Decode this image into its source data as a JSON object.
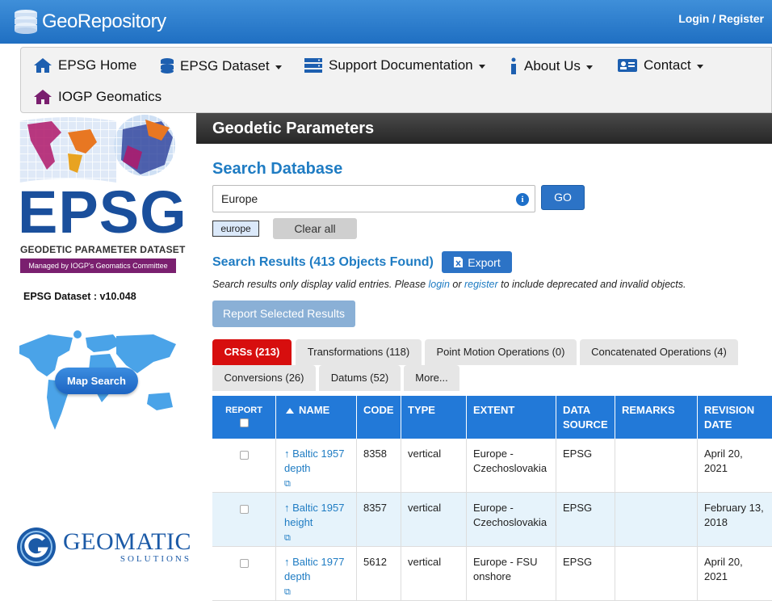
{
  "header": {
    "brand": "GeoRepository",
    "login": "Login / Register"
  },
  "nav": {
    "items": [
      {
        "label": "EPSG Home",
        "icon": "home-icon"
      },
      {
        "label": "EPSG Dataset",
        "icon": "database-icon"
      },
      {
        "label": "Support Documentation",
        "icon": "server-icon"
      },
      {
        "label": "About Us",
        "icon": "info-icon"
      },
      {
        "label": "Contact",
        "icon": "contact-card-icon"
      },
      {
        "label": "IOGP Geomatics",
        "icon": "home-icon"
      }
    ]
  },
  "sidebar": {
    "logo_text": "EPSG",
    "logo_sub": "GEODETIC PARAMETER DATASET",
    "logo_managed": "Managed by IOGP's Geomatics Committee",
    "dataset_version": "EPSG Dataset :  v10.048",
    "map_search": "Map Search",
    "geomatic_line1": "GEOMATIC",
    "geomatic_line2": "SOLUTIONS"
  },
  "main": {
    "section_title": "Geodetic Parameters",
    "search_title": "Search Database",
    "search_value": "Europe",
    "go_label": "GO",
    "tag": "europe",
    "clear_all": "Clear all",
    "results_title": "Search Results (413 Objects Found)",
    "export_label": "Export",
    "note_pre": "Search results only display valid entries. Please ",
    "note_login": "login",
    "note_mid": " or ",
    "note_register": "register",
    "note_post": " to include deprecated and invalid objects.",
    "report_selected": "Report Selected Results"
  },
  "tabs": [
    {
      "label": "CRSs (213)",
      "active": true
    },
    {
      "label": "Transformations (118)"
    },
    {
      "label": "Point Motion Operations (0)"
    },
    {
      "label": "Concatenated Operations (4)"
    },
    {
      "label": "Conversions (26)"
    },
    {
      "label": "Datums (52)"
    },
    {
      "label": "More..."
    }
  ],
  "table": {
    "headers": {
      "report": "REPORT",
      "name": "NAME",
      "code": "CODE",
      "type": "TYPE",
      "extent": "EXTENT",
      "source": "DATA SOURCE",
      "remarks": "REMARKS",
      "revision": "REVISION DATE"
    },
    "rows": [
      {
        "name": "Baltic 1957 depth",
        "code": "8358",
        "type": "vertical",
        "extent": "Europe - Czechoslovakia",
        "source": "EPSG",
        "remarks": "",
        "revision": "April 20, 2021"
      },
      {
        "name": "Baltic 1957 height",
        "code": "8357",
        "type": "vertical",
        "extent": "Europe - Czechoslovakia",
        "source": "EPSG",
        "remarks": "",
        "revision": "February 13, 2018"
      },
      {
        "name": "Baltic 1977 depth",
        "code": "5612",
        "type": "vertical",
        "extent": "Europe - FSU onshore",
        "source": "EPSG",
        "remarks": "",
        "revision": "April 20, 2021"
      }
    ]
  },
  "colors": {
    "brand_blue": "#1f7cc3",
    "active_tab": "#d70e0e",
    "table_header": "#2279d8"
  }
}
